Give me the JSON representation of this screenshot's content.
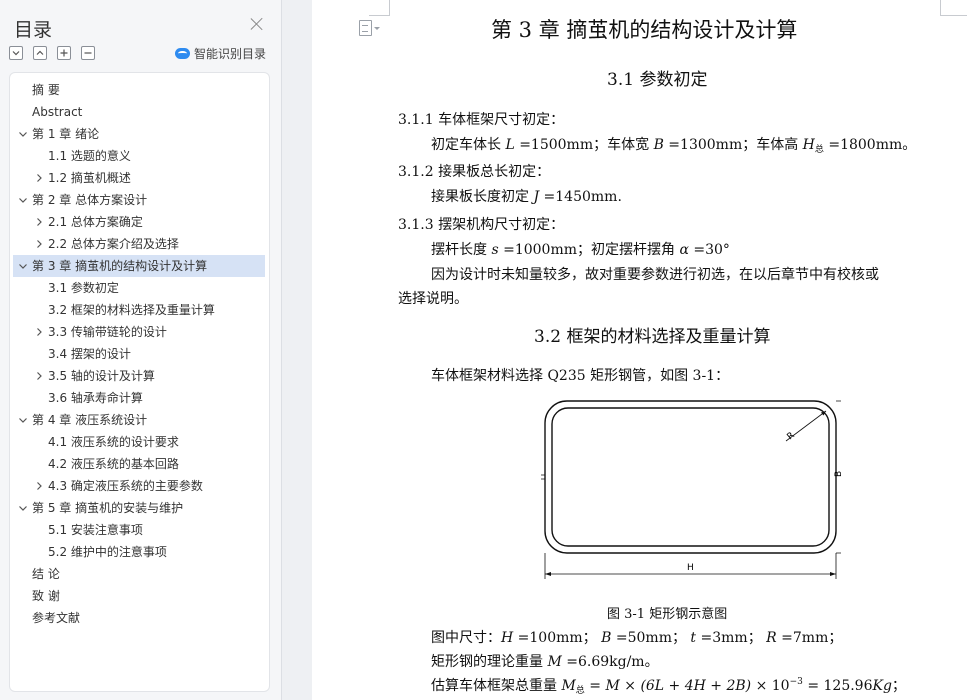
{
  "sidebar": {
    "title": "目录",
    "ai_label": "智能识别目录",
    "items": [
      {
        "label": "摘  要",
        "level": 1,
        "toggle": "none"
      },
      {
        "label": "Abstract",
        "level": 1,
        "toggle": "none"
      },
      {
        "label": "第 1 章   绪论",
        "level": 1,
        "toggle": "expanded"
      },
      {
        "label": "1.1   选题的意义",
        "level": 2,
        "toggle": "none"
      },
      {
        "label": "1.2   摘茧机概述",
        "level": 2,
        "toggle": "collapsed"
      },
      {
        "label": "第 2 章   总体方案设计",
        "level": 1,
        "toggle": "expanded"
      },
      {
        "label": "2.1   总体方案确定",
        "level": 2,
        "toggle": "collapsed"
      },
      {
        "label": "2.2   总体方案介绍及选择",
        "level": 2,
        "toggle": "collapsed"
      },
      {
        "label": "第 3 章   摘茧机的结构设计及计算",
        "level": 1,
        "toggle": "expanded",
        "active": true
      },
      {
        "label": "3.1   参数初定",
        "level": 2,
        "toggle": "none"
      },
      {
        "label": "3.2  框架的材料选择及重量计算",
        "level": 2,
        "toggle": "none"
      },
      {
        "label": "3.3  传输带链轮的设计",
        "level": 2,
        "toggle": "collapsed"
      },
      {
        "label": "3.4 摆架的设计",
        "level": 2,
        "toggle": "none"
      },
      {
        "label": "3.5  轴的设计及计算",
        "level": 2,
        "toggle": "collapsed"
      },
      {
        "label": "3.6 轴承寿命计算",
        "level": 2,
        "toggle": "none"
      },
      {
        "label": "第 4 章  液压系统设计",
        "level": 1,
        "toggle": "expanded"
      },
      {
        "label": "4.1  液压系统的设计要求",
        "level": 2,
        "toggle": "none"
      },
      {
        "label": "4.2  液压系统的基本回路",
        "level": 2,
        "toggle": "none"
      },
      {
        "label": "4.3 确定液压系统的主要参数",
        "level": 2,
        "toggle": "collapsed"
      },
      {
        "label": "第 5 章   摘茧机的安装与维护",
        "level": 1,
        "toggle": "expanded"
      },
      {
        "label": "5.1   安装注意事项",
        "level": 2,
        "toggle": "none"
      },
      {
        "label": "5.2   维护中的注意事项",
        "level": 2,
        "toggle": "none"
      },
      {
        "label": "结   论",
        "level": 1,
        "toggle": "none"
      },
      {
        "label": "致   谢",
        "level": 1,
        "toggle": "none"
      },
      {
        "label": "参考文献",
        "level": 1,
        "toggle": "none"
      }
    ]
  },
  "doc": {
    "chapter_title": "第 3 章    摘茧机的结构设计及计算",
    "s31_title": "3.1    参数初定",
    "s311_head": "3.1.1  车体框架尺寸初定：",
    "s311_line": {
      "p1": "初定车体长 ",
      "L": "L",
      "p2": " =1500mm；车体宽 ",
      "B": "B",
      "p3": " =1300mm；车体高 ",
      "H": "H",
      "Hsub": "总",
      "p4": " =1800mm。"
    },
    "s312_head": "3.1.2  接果板总长初定：",
    "s312_line": {
      "p1": "接果板长度初定 ",
      "J": "J",
      "p2": " =1450mm."
    },
    "s313_head": "3.1.3  摆架机构尺寸初定：",
    "s313_line": {
      "p1": "摆杆长度 ",
      "s": "s",
      "p2": " =1000mm；初定摆杆摆角 ",
      "alpha": "α",
      "p3": " =30°"
    },
    "para_1": "因为设计时未知量较多，故对重要参数进行初选，在以后章节中有校核或",
    "para_2": "选择说明。",
    "s32_title": "3.2  框架的材料选择及重量计算",
    "s32_intro": "车体框架材料选择 Q235 矩形钢管，如图 3-1：",
    "fig_labels": {
      "R": "R",
      "t": "t",
      "B": "B",
      "H": "H"
    },
    "fig_caption": "图 3-1  矩形钢示意图",
    "dims_line": {
      "p1": "图中尺寸：",
      "H": "H",
      "v1": " =100mm；  ",
      "B": "B",
      "v2": " =50mm；  ",
      "t": "t",
      "v3": " =3mm；  ",
      "R": "R",
      "v4": " =7mm；"
    },
    "weight_line": {
      "p1": "矩形钢的理论重量 ",
      "M": "M",
      "p2": " =6.69kg/m。"
    },
    "total_line": {
      "p1": "估算车体框架总重量 ",
      "M": "M",
      "sub": "总",
      "eq": " = ",
      "M2": "M",
      "times": " × ",
      "expr": "(6L + 4H + 2B)",
      "times2": " × 10",
      "exp": "−3",
      "res": " = 125.96",
      "unit": "Kg",
      "end": "；"
    }
  }
}
